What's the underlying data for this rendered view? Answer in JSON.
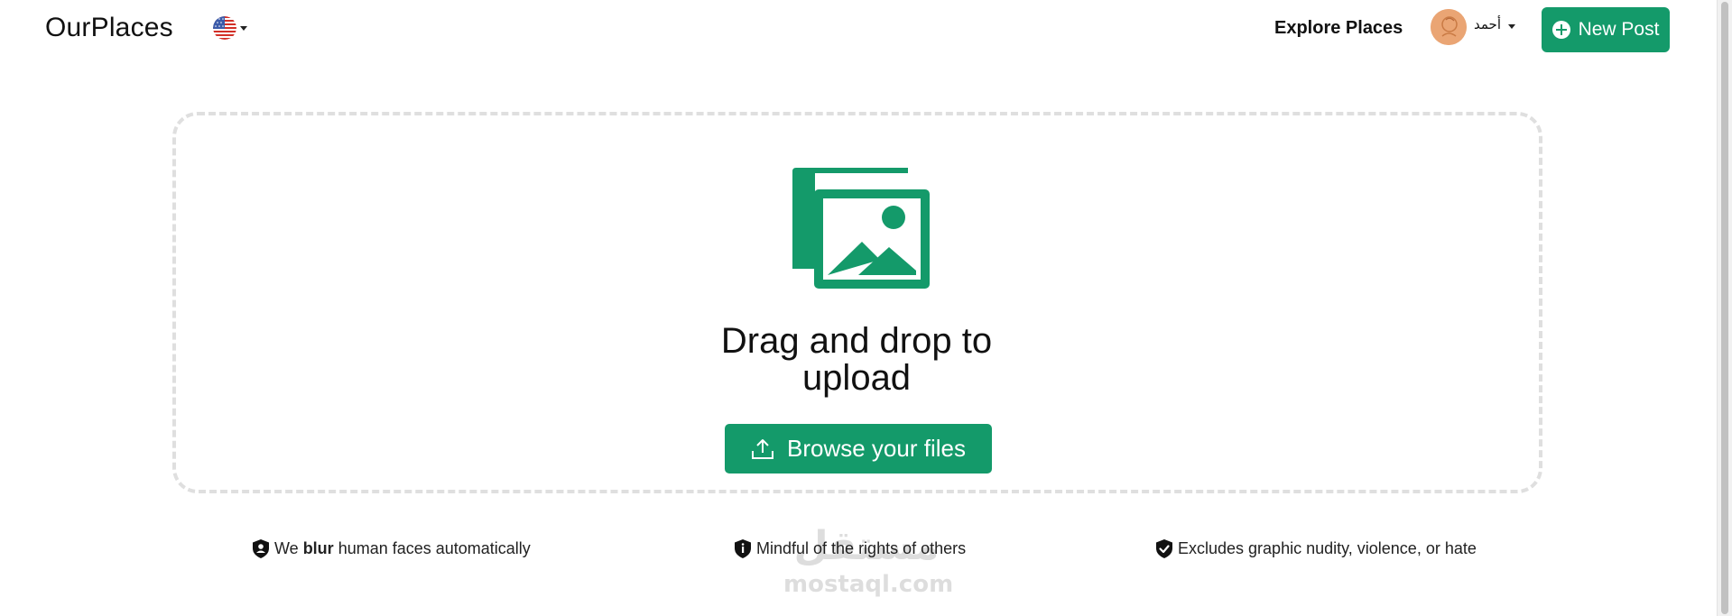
{
  "header": {
    "logo": "OurPlaces",
    "language": {
      "flag_icon": "us-flag-icon"
    },
    "explore_label": "Explore Places",
    "user": {
      "name": "أحمد",
      "avatar_icon": "avatar"
    },
    "new_post_label": "New Post"
  },
  "upload": {
    "title": "Drag and drop to upload",
    "browse_label": "Browse your files"
  },
  "features": [
    {
      "pre": "We ",
      "bold": "blur",
      "post": " human faces automatically",
      "icon": "shield-user-icon"
    },
    {
      "text": "Mindful of the rights of others",
      "icon": "shield-info-icon"
    },
    {
      "text": "Excludes graphic nudity, violence, or hate",
      "icon": "shield-check-icon"
    }
  ],
  "watermark": {
    "arabic": "مستقل",
    "latin": "mostaql.com"
  },
  "colors": {
    "primary": "#149a6a",
    "dash_border": "#dfdfdf",
    "text": "#111111"
  }
}
